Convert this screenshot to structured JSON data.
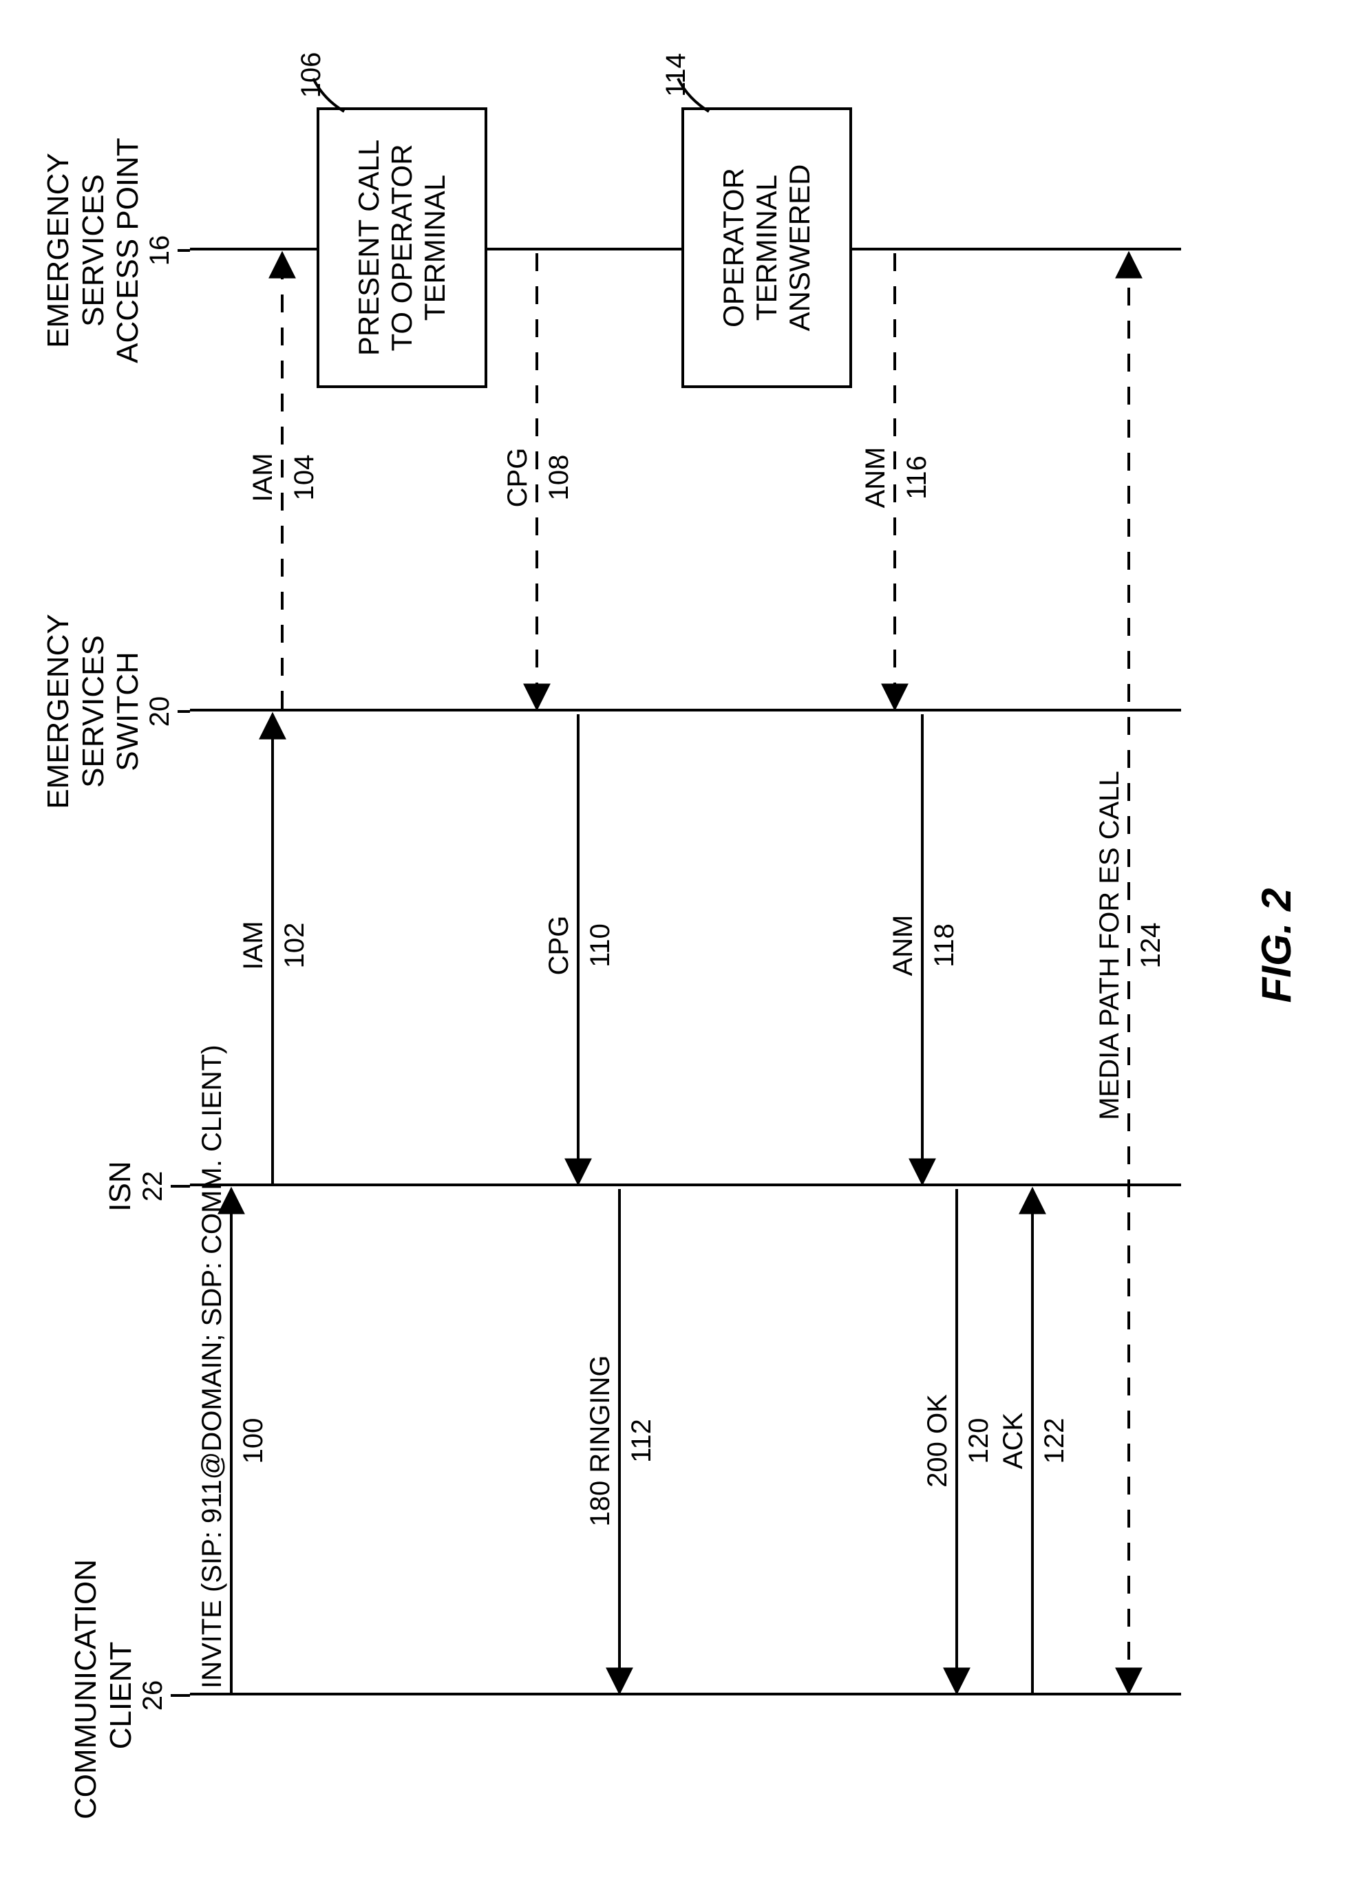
{
  "figure_label": "FIG. 2",
  "lifelines": {
    "comm_client": {
      "title": "COMMUNICATION\nCLIENT",
      "ref": "26"
    },
    "isn": {
      "title": "ISN",
      "ref": "22"
    },
    "es_switch": {
      "title": "EMERGENCY\nSERVICES\nSWITCH",
      "ref": "20"
    },
    "es_ap": {
      "title": "EMERGENCY\nSERVICES\nACCESS POINT",
      "ref": "16"
    }
  },
  "messages": {
    "m100": {
      "label": "INVITE (SIP: 911@DOMAIN; SDP: COMM. CLIENT)",
      "ref": "100"
    },
    "m102": {
      "label": "IAM",
      "ref": "102"
    },
    "m104": {
      "label": "IAM",
      "ref": "104"
    },
    "m108": {
      "label": "CPG",
      "ref": "108"
    },
    "m110": {
      "label": "CPG",
      "ref": "110"
    },
    "m112": {
      "label": "180 RINGING",
      "ref": "112"
    },
    "m116": {
      "label": "ANM",
      "ref": "116"
    },
    "m118": {
      "label": "ANM",
      "ref": "118"
    },
    "m120": {
      "label": "200 OK",
      "ref": "120"
    },
    "m122": {
      "label": "ACK",
      "ref": "122"
    },
    "m124": {
      "label": "MEDIA PATH FOR ES CALL",
      "ref": "124"
    }
  },
  "actions": {
    "a106": {
      "label": "PRESENT CALL\nTO OPERATOR\nTERMINAL",
      "ref": "106"
    },
    "a114": {
      "label": "OPERATOR\nTERMINAL\nANSWERED",
      "ref": "114"
    }
  },
  "chart_data": {
    "type": "sequence-diagram",
    "lifelines": [
      {
        "id": "CC",
        "name": "COMMUNICATION CLIENT",
        "ref": "26"
      },
      {
        "id": "ISN",
        "name": "ISN",
        "ref": "22"
      },
      {
        "id": "ESS",
        "name": "EMERGENCY SERVICES SWITCH",
        "ref": "20"
      },
      {
        "id": "ESAP",
        "name": "EMERGENCY SERVICES ACCESS POINT",
        "ref": "16"
      }
    ],
    "events": [
      {
        "ref": "100",
        "from": "CC",
        "to": "ISN",
        "label": "INVITE (SIP: 911@DOMAIN; SDP: COMM. CLIENT)",
        "style": "solid"
      },
      {
        "ref": "102",
        "from": "ISN",
        "to": "ESS",
        "label": "IAM",
        "style": "solid"
      },
      {
        "ref": "104",
        "from": "ESS",
        "to": "ESAP",
        "label": "IAM",
        "style": "dashed"
      },
      {
        "ref": "106",
        "at": "ESAP",
        "action": "PRESENT CALL TO OPERATOR TERMINAL"
      },
      {
        "ref": "108",
        "from": "ESAP",
        "to": "ESS",
        "label": "CPG",
        "style": "dashed"
      },
      {
        "ref": "110",
        "from": "ESS",
        "to": "ISN",
        "label": "CPG",
        "style": "solid"
      },
      {
        "ref": "112",
        "from": "ISN",
        "to": "CC",
        "label": "180 RINGING",
        "style": "solid"
      },
      {
        "ref": "114",
        "at": "ESAP",
        "action": "OPERATOR TERMINAL ANSWERED"
      },
      {
        "ref": "116",
        "from": "ESAP",
        "to": "ESS",
        "label": "ANM",
        "style": "dashed"
      },
      {
        "ref": "118",
        "from": "ESS",
        "to": "ISN",
        "label": "ANM",
        "style": "solid"
      },
      {
        "ref": "120",
        "from": "ISN",
        "to": "CC",
        "label": "200 OK",
        "style": "solid"
      },
      {
        "ref": "122",
        "from": "CC",
        "to": "ISN",
        "label": "ACK",
        "style": "solid"
      },
      {
        "ref": "124",
        "from": "CC",
        "to": "ESAP",
        "label": "MEDIA PATH FOR ES CALL",
        "style": "dashed",
        "bidirectional": true
      }
    ],
    "title": "FIG. 2"
  }
}
